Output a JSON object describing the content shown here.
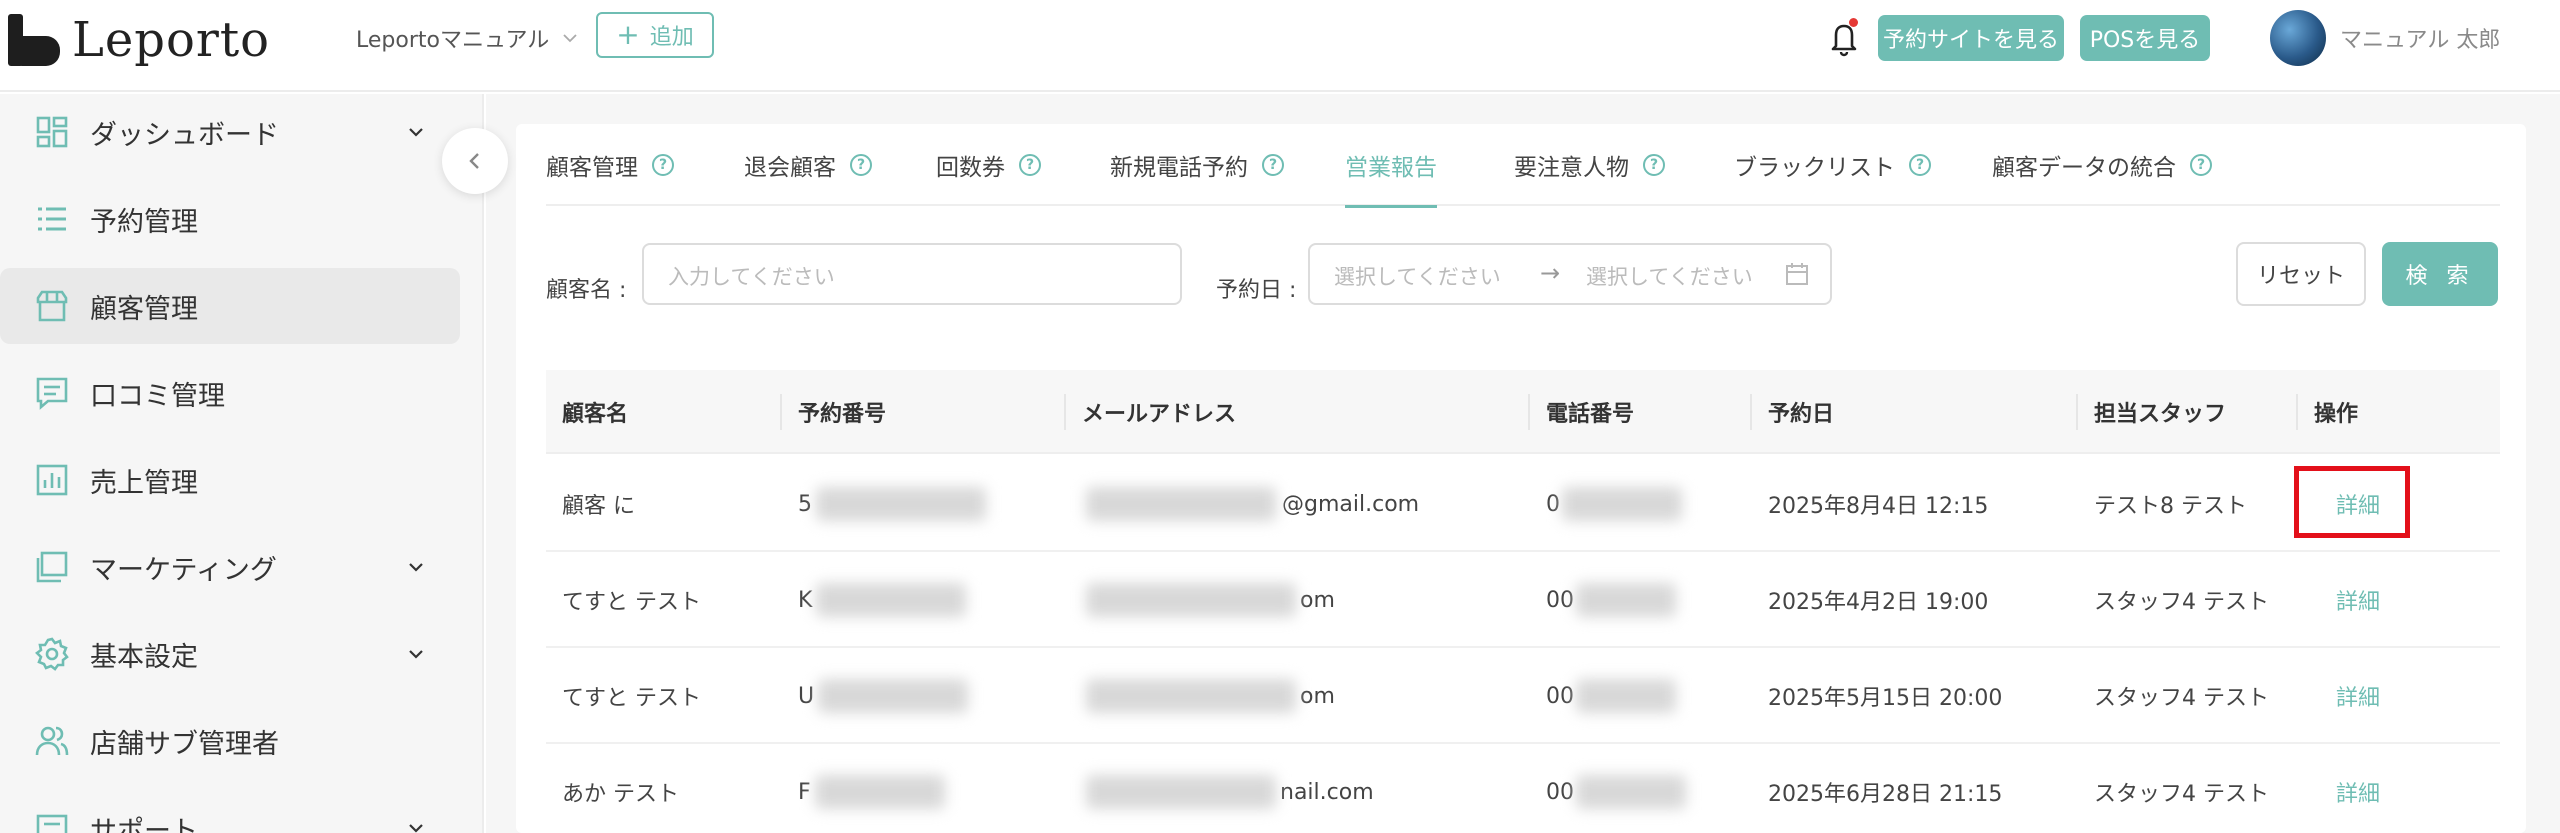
{
  "header": {
    "logo_text": "Leporto",
    "store_name": "Leportoマニュアル",
    "add_label": "追加",
    "reserve_site_label": "予約サイトを見る",
    "pos_label": "POSを見る",
    "user_name": "マニュアル 太郎"
  },
  "sidebar": {
    "items": [
      {
        "label": "ダッシュボード",
        "icon": "dashboard-icon",
        "has_children": true
      },
      {
        "label": "予約管理",
        "icon": "list-icon",
        "has_children": false
      },
      {
        "label": "顧客管理",
        "icon": "store-icon",
        "has_children": false,
        "active": true
      },
      {
        "label": "口コミ管理",
        "icon": "comment-icon",
        "has_children": false
      },
      {
        "label": "売上管理",
        "icon": "chart-icon",
        "has_children": false
      },
      {
        "label": "マーケティング",
        "icon": "window-icon",
        "has_children": true
      },
      {
        "label": "基本設定",
        "icon": "gear-icon",
        "has_children": true
      },
      {
        "label": "店舗サブ管理者",
        "icon": "users-icon",
        "has_children": false
      },
      {
        "label": "サポート",
        "icon": "support-icon",
        "has_children": true
      }
    ]
  },
  "tabs": [
    {
      "label": "顧客管理",
      "help": true
    },
    {
      "label": "退会顧客",
      "help": true
    },
    {
      "label": "回数券",
      "help": true
    },
    {
      "label": "新規電話予約",
      "help": true
    },
    {
      "label": "営業報告",
      "help": false,
      "active": true
    },
    {
      "label": "要注意人物",
      "help": true
    },
    {
      "label": "ブラックリスト",
      "help": true
    },
    {
      "label": "顧客データの統合",
      "help": true
    }
  ],
  "filters": {
    "customer_label": "顧客名 :",
    "customer_placeholder": "入力してください",
    "date_label": "予約日 :",
    "date_start_placeholder": "選択してください",
    "date_arrow": "→",
    "date_end_placeholder": "選択してください",
    "reset_label": "リセット",
    "search_label": "検 索"
  },
  "table": {
    "columns": [
      "顧客名",
      "予約番号",
      "メールアドレス",
      "電話番号",
      "予約日",
      "担当スタッフ",
      "操作"
    ],
    "rows": [
      {
        "name": "顧客 に",
        "reservation_no": "5",
        "email": "@gmail.com",
        "phone": "0",
        "date": "2025年8月4日 12:15",
        "staff": "テスト8 テスト",
        "action": "詳細",
        "highlighted": true
      },
      {
        "name": "てすと テスト",
        "reservation_no": "K",
        "email": "om",
        "phone": "00",
        "date": "2025年4月2日 19:00",
        "staff": "スタッフ4 テスト",
        "action": "詳細"
      },
      {
        "name": "てすと テスト",
        "reservation_no": "U",
        "email": "om",
        "phone": "00",
        "date": "2025年5月15日 20:00",
        "staff": "スタッフ4 テスト",
        "action": "詳細"
      },
      {
        "name": "あか テスト",
        "reservation_no": "F",
        "email": "nail.com",
        "phone": "00",
        "date": "2025年6月28日 21:15",
        "staff": "スタッフ4 テスト",
        "action": "詳細"
      }
    ]
  },
  "colors": {
    "accent": "#6fbdb3",
    "highlight_box": "#e3101a",
    "notification_dot": "#e53935"
  }
}
